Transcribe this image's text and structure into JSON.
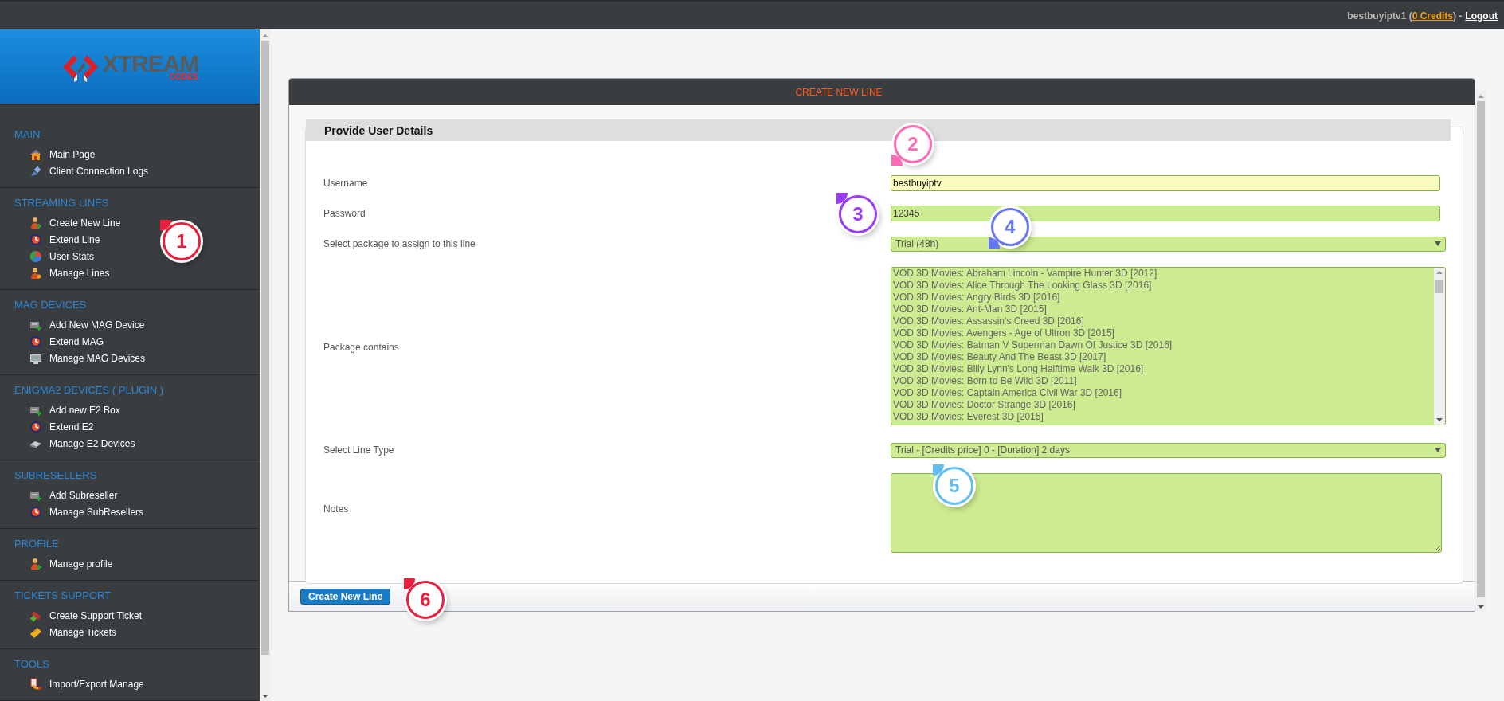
{
  "topbar": {
    "account": [
      {
        "kind": "text",
        "text": "bestbuyiptv1 ("
      },
      {
        "kind": "credits",
        "text": "0 Credits"
      },
      {
        "kind": "text",
        "text": ") -"
      },
      {
        "kind": "logout",
        "text": "Logout"
      }
    ]
  },
  "logo": {
    "name": "XTREAM",
    "sub": "CODES"
  },
  "sidebar": {
    "sections": [
      {
        "title": "MAIN",
        "items": [
          {
            "label": "Main Page"
          },
          {
            "label": "Client Connection Logs"
          }
        ]
      },
      {
        "title": "STREAMING LINES",
        "items": [
          {
            "label": "Create New Line"
          },
          {
            "label": "Extend Line"
          },
          {
            "label": "User Stats"
          },
          {
            "label": "Manage Lines"
          }
        ]
      },
      {
        "title": "MAG DEVICES",
        "items": [
          {
            "label": "Add New MAG Device"
          },
          {
            "label": "Extend MAG"
          },
          {
            "label": "Manage MAG Devices"
          }
        ]
      },
      {
        "title": "ENIGMA2 DEVICES ( PLUGIN )",
        "items": [
          {
            "label": "Add new E2 Box"
          },
          {
            "label": "Extend E2"
          },
          {
            "label": "Manage E2 Devices"
          }
        ]
      },
      {
        "title": "SUBRESELLERS",
        "items": [
          {
            "label": "Add Subreseller"
          },
          {
            "label": "Manage SubResellers"
          }
        ]
      },
      {
        "title": "PROFILE",
        "items": [
          {
            "label": "Manage profile"
          }
        ]
      },
      {
        "title": "TICKETS SUPPORT",
        "items": [
          {
            "label": "Create Support Ticket"
          },
          {
            "label": "Manage Tickets"
          }
        ]
      },
      {
        "title": "TOOLS",
        "items": [
          {
            "label": "Import/Export Manage"
          }
        ]
      }
    ]
  },
  "panel": {
    "title": "CREATE NEW LINE",
    "legend": "Provide User Details",
    "fields": [
      {
        "kind": "input",
        "label": "Username",
        "value": "bestbuyiptv",
        "focused": true
      },
      {
        "kind": "input",
        "label": "Password",
        "value": "12345",
        "focused": false
      },
      {
        "kind": "select",
        "label": "Select package to assign to this line",
        "value": "Trial (48h)"
      },
      {
        "kind": "list",
        "label": "Package contains",
        "options": [
          "VOD 3D Movies: Abraham Lincoln - Vampire Hunter 3D [2012]",
          "VOD 3D Movies: Alice Through The Looking Glass 3D [2016]",
          "VOD 3D Movies: Angry Birds 3D [2016]",
          "VOD 3D Movies: Ant-Man 3D [2015]",
          "VOD 3D Movies: Assassin's Creed 3D [2016]",
          "VOD 3D Movies: Avengers - Age of Ultron 3D [2015]",
          "VOD 3D Movies: Batman V Superman Dawn Of Justice 3D [2016]",
          "VOD 3D Movies: Beauty And The Beast 3D [2017]",
          "VOD 3D Movies: Billy Lynn's Long Halftime Walk 3D [2016]",
          "VOD 3D Movies: Born to Be Wild 3D [2011]",
          "VOD 3D Movies: Captain America Civil War 3D [2016]",
          "VOD 3D Movies: Doctor Strange 3D [2016]",
          "VOD 3D Movies: Everest 3D [2015]"
        ]
      },
      {
        "kind": "select",
        "label": "Select Line Type",
        "value": "Trial - [Credits price] 0 - [Duration] 2 days"
      },
      {
        "kind": "textarea",
        "label": "Notes"
      }
    ],
    "submit": "Create New Line"
  },
  "markers": [
    {
      "number": "1",
      "color": "#e8203e"
    },
    {
      "number": "2",
      "color": "#ff6ab4"
    },
    {
      "number": "3",
      "color": "#9a3cf2"
    },
    {
      "number": "4",
      "color": "#6676ee"
    },
    {
      "number": "5",
      "color": "#64bdf0"
    },
    {
      "number": "6",
      "color": "#e8203e"
    }
  ]
}
